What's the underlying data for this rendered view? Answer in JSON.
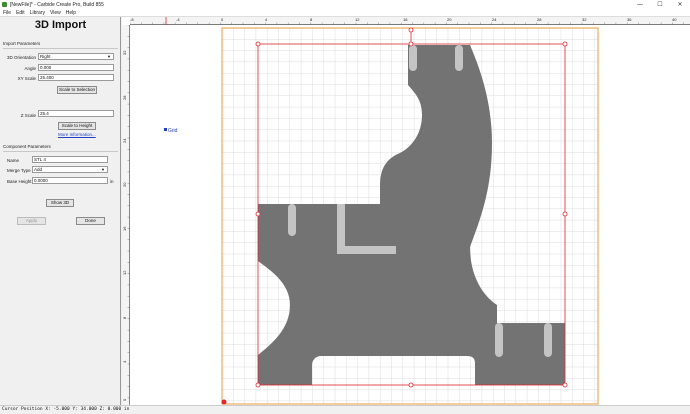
{
  "window": {
    "title": "[NewFile]* - Carbide Create Pro, Build 855",
    "minimize": "—",
    "maximize": "☐",
    "close": "✕"
  },
  "menu": [
    "File",
    "Edit",
    "Library",
    "View",
    "Help"
  ],
  "panel": {
    "heading": "3D Import",
    "import_section": "Import Parameters",
    "orientation_label": "3D Orientation",
    "orientation_value": "Right",
    "angle_label": "Angle",
    "angle_value": "0.000",
    "xy_scale_label": "XY Scale",
    "xy_scale_value": "25.400",
    "scale_to_selection": "Scale to Selection",
    "z_scale_label": "Z Scale",
    "z_scale_value": "25.4",
    "scale_to_height": "Scale to Height",
    "more_info": "More Information...",
    "component_section": "Component Parameters",
    "name_label": "Name",
    "name_value": "STL 4",
    "merge_label": "Merge Type",
    "merge_value": "Add",
    "base_height_label": "Base Height",
    "base_height_value": "0.0000",
    "base_height_unit": "in",
    "show3d": "Show 3D",
    "apply": "Apply",
    "done": "Done"
  },
  "rulers": {
    "horizontal": [
      "-8",
      "-4",
      "0",
      "4",
      "8",
      "12",
      "16",
      "20",
      "24",
      "28",
      "32",
      "36",
      "40"
    ],
    "vertical": [
      "32",
      "28",
      "24",
      "20",
      "16",
      "12",
      "8",
      "4",
      "0"
    ]
  },
  "grid_label": "Grid",
  "colors": {
    "part": "#737373",
    "part_light": "#c4c4c4",
    "selection": "#e0262b",
    "material_border": "#e89a3c",
    "grid": "#d8d8d8",
    "link": "#1f3fbf"
  },
  "status": "Cursor Position X: -5.000 Y: 34.000 Z: 0.000 in"
}
